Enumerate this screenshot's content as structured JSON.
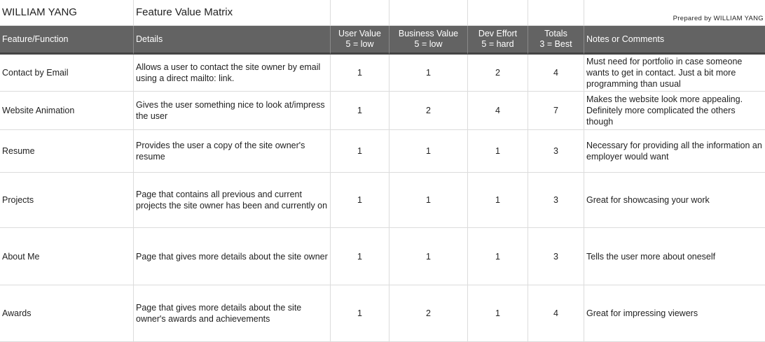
{
  "title": {
    "author": "WILLIAM YANG",
    "sheet_name": "Feature Value Matrix",
    "prepared_by": "Prepared by WILLIAM YANG"
  },
  "headers": {
    "feature": "Feature/Function",
    "details": "Details",
    "user_value": {
      "line1": "User Value",
      "line2": "5 = low"
    },
    "business_value": {
      "line1": "Business Value",
      "line2": "5 = low"
    },
    "dev_effort": {
      "line1": "Dev Effort",
      "line2": "5 = hard"
    },
    "totals": {
      "line1": "Totals",
      "line2": "3 = Best"
    },
    "notes": "Notes or Comments"
  },
  "rows": [
    {
      "feature": "Contact by Email",
      "details": "Allows a user to contact the site owner by email using a direct mailto: link.",
      "user_value": "1",
      "business_value": "1",
      "dev_effort": "2",
      "totals": "4",
      "notes": "Must need for portfolio in case someone wants to get in contact. Just a bit more programming than usual"
    },
    {
      "feature": "Website Animation",
      "details": "Gives the user something nice to look at/impress the user",
      "user_value": "1",
      "business_value": "2",
      "dev_effort": "4",
      "totals": "7",
      "notes": "Makes the website look more appealing. Definitely more complicated the others though"
    },
    {
      "feature": "Resume",
      "details": "Provides the user a copy of the site owner's resume",
      "user_value": "1",
      "business_value": "1",
      "dev_effort": "1",
      "totals": "3",
      "notes": "Necessary for providing all the information an employer would want"
    },
    {
      "feature": "Projects",
      "details": "Page that contains all previous and current projects the site owner has been and currently on",
      "user_value": "1",
      "business_value": "1",
      "dev_effort": "1",
      "totals": "3",
      "notes": "Great for showcasing your work"
    },
    {
      "feature": "About Me",
      "details": "Page that gives more details about the site owner",
      "user_value": "1",
      "business_value": "1",
      "dev_effort": "1",
      "totals": "3",
      "notes": "Tells the user more about oneself"
    },
    {
      "feature": "Awards",
      "details": "Page that gives more details about the site owner's awards and achievements",
      "user_value": "1",
      "business_value": "2",
      "dev_effort": "1",
      "totals": "4",
      "notes": "Great for impressing viewers"
    }
  ]
}
